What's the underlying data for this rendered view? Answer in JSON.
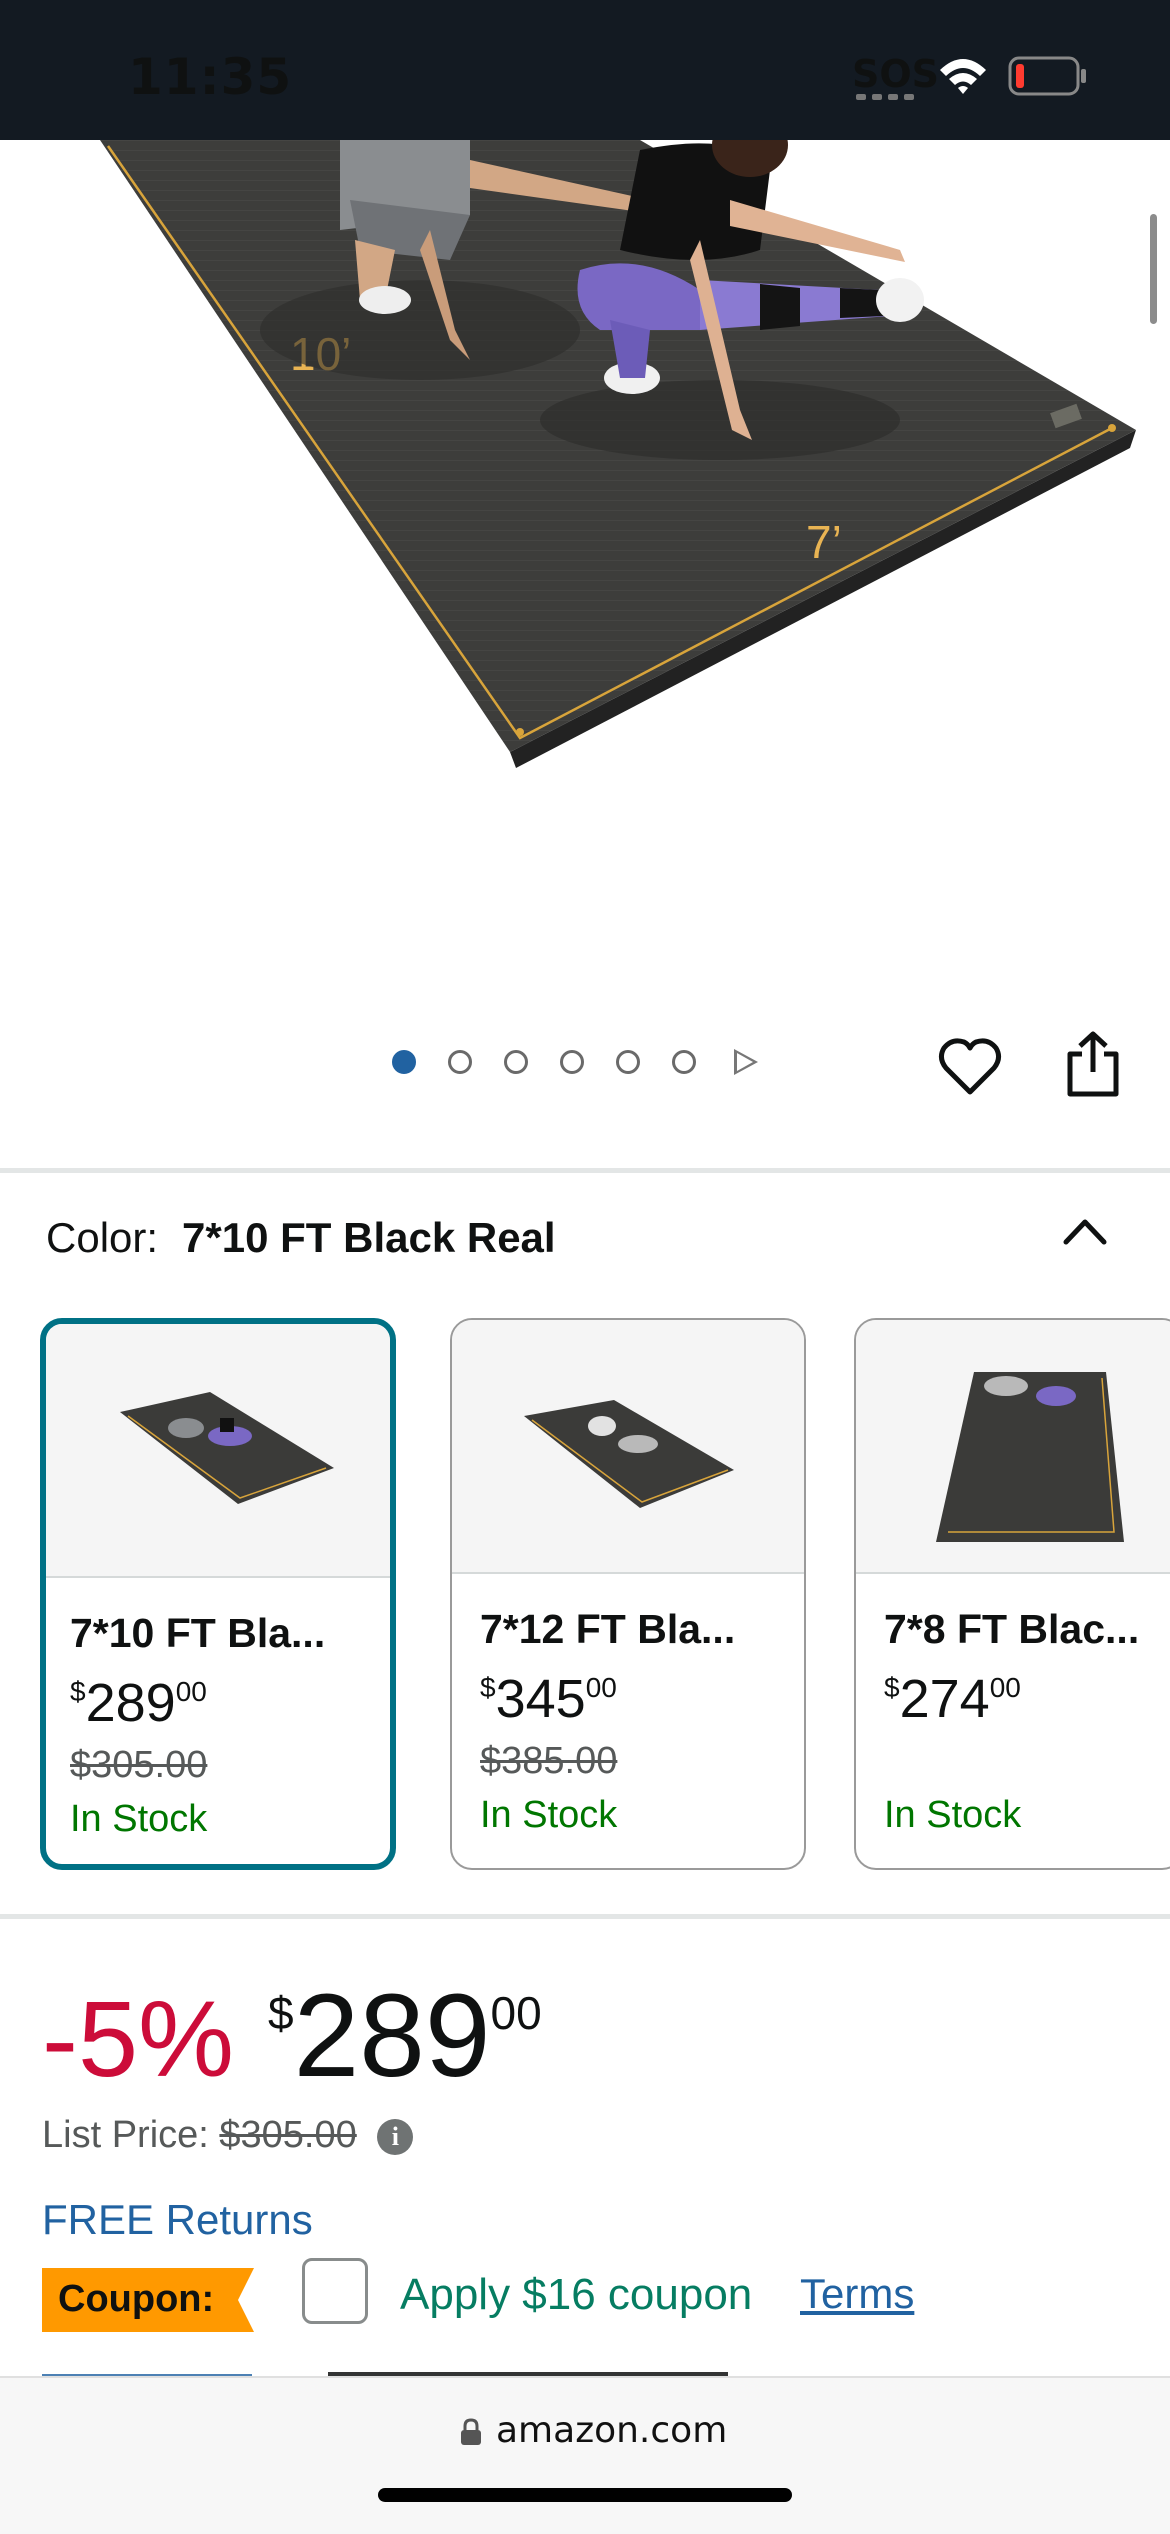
{
  "status_bar": {
    "time": "11:35",
    "sos": "SOS"
  },
  "product_image": {
    "dimension_labels": [
      "10’",
      "7’"
    ]
  },
  "carousel": {
    "total_images": 6,
    "active_index": 0
  },
  "color": {
    "label": "Color:",
    "selected_value": "7*10 FT Black Real"
  },
  "variants": [
    {
      "title": "7*10 FT Bla...",
      "currency": "$",
      "price_whole": "289",
      "price_fraction": "00",
      "list_price": "$305.00",
      "stock": "In Stock",
      "selected": true
    },
    {
      "title": "7*12 FT Bla...",
      "currency": "$",
      "price_whole": "345",
      "price_fraction": "00",
      "list_price": "$385.00",
      "stock": "In Stock",
      "selected": false
    },
    {
      "title": "7*8 FT Blac...",
      "currency": "$",
      "price_whole": "274",
      "price_fraction": "00",
      "list_price": "",
      "stock": "In Stock",
      "selected": false
    }
  ],
  "price": {
    "discount": "-5%",
    "currency": "$",
    "whole": "289",
    "fraction": "00",
    "list_price_label": "List Price:",
    "list_price_value": "$305.00"
  },
  "returns": "FREE Returns",
  "coupon": {
    "badge": "Coupon:",
    "apply_text": "Apply $16 coupon",
    "terms": "Terms",
    "checked": false
  },
  "browser": {
    "url": "amazon.com"
  },
  "colors": {
    "accent_teal": "#007185",
    "discount_red": "#cc0c39",
    "link_blue": "#2162a1",
    "stock_green": "#007600",
    "coupon_orange": "#ff9900"
  }
}
